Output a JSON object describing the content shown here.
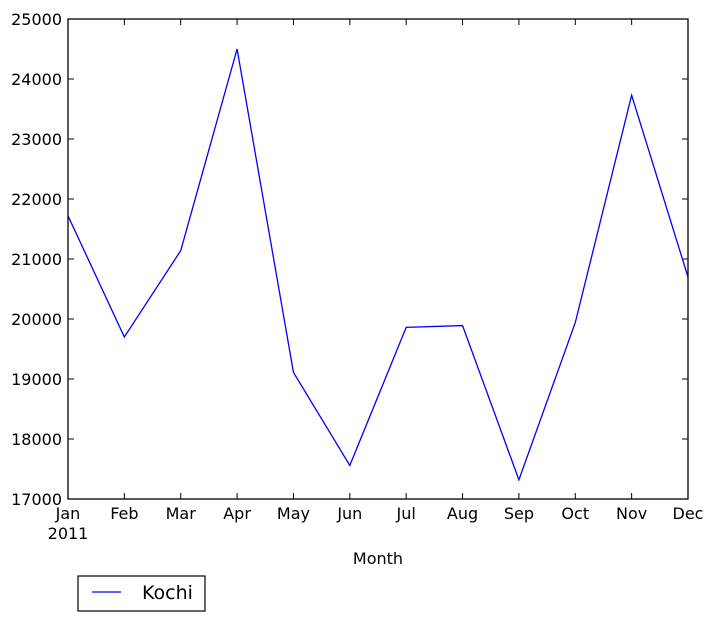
{
  "chart_data": {
    "type": "line",
    "title": "",
    "xlabel": "Month",
    "ylabel": "",
    "categories": [
      "Jan",
      "Feb",
      "Mar",
      "Apr",
      "May",
      "Jun",
      "Jul",
      "Aug",
      "Sep",
      "Oct",
      "Nov",
      "Dec"
    ],
    "x_tick_labels": [
      "Jan",
      "Feb",
      "Mar",
      "Apr",
      "May",
      "Jun",
      "Jul",
      "Aug",
      "Sep",
      "Oct",
      "Nov",
      "Dec"
    ],
    "x_year_label": "2011",
    "ylim": [
      17000,
      25000
    ],
    "y_ticks": [
      17000,
      18000,
      19000,
      20000,
      21000,
      22000,
      23000,
      24000,
      25000
    ],
    "grid": false,
    "series": [
      {
        "name": "Kochi",
        "color": "#0000ff",
        "values": [
          21720,
          19700,
          21140,
          24500,
          19110,
          17560,
          19860,
          19890,
          17320,
          19940,
          23730,
          20700
        ]
      }
    ],
    "legend": {
      "placement": "below-left",
      "entries": [
        "Kochi"
      ]
    }
  }
}
